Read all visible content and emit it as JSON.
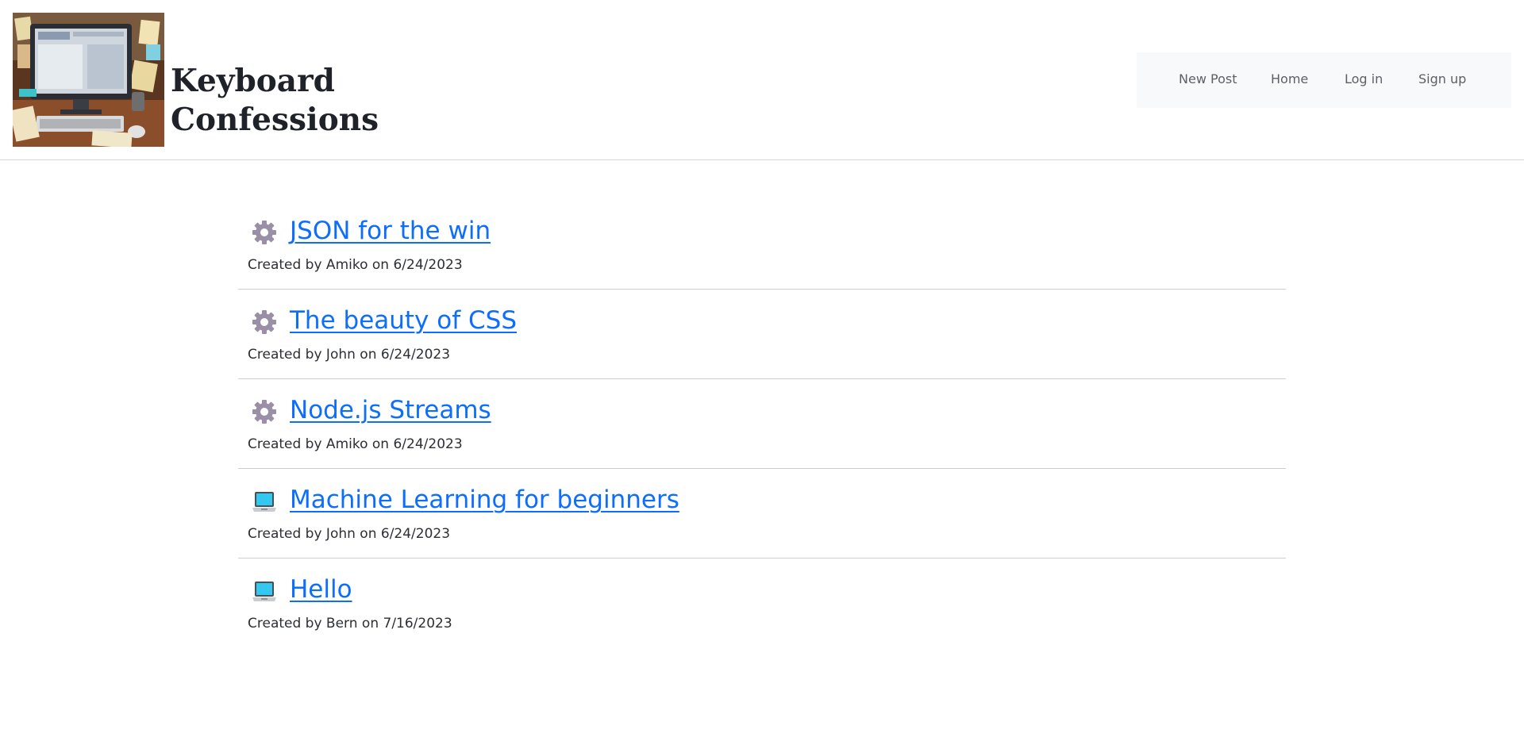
{
  "header": {
    "brand": {
      "line1": "Keyboard",
      "line2": "Confessions"
    },
    "nav": {
      "new_post": "New Post",
      "home": "Home",
      "login": "Log in",
      "signup": "Sign up"
    }
  },
  "posts": [
    {
      "icon": "gear-icon",
      "title": "JSON for the win",
      "meta": "Created by Amiko on 6/24/2023"
    },
    {
      "icon": "gear-icon",
      "title": "The beauty of CSS",
      "meta": "Created by John on 6/24/2023"
    },
    {
      "icon": "gear-icon",
      "title": "Node.js Streams",
      "meta": "Created by Amiko on 6/24/2023"
    },
    {
      "icon": "laptop-icon",
      "title": "Machine Learning for beginners",
      "meta": "Created by John on 6/24/2023"
    },
    {
      "icon": "laptop-icon",
      "title": "Hello",
      "meta": "Created by Bern on 7/16/2023"
    }
  ],
  "colors": {
    "link": "#0d6efd",
    "navbar_bg": "#f8f9fa",
    "gear": "#9a8fa6",
    "laptop_screen": "#33c8f0"
  }
}
